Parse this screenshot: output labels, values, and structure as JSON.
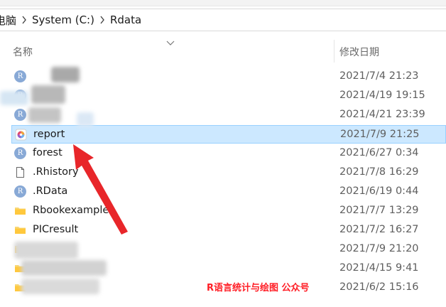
{
  "breadcrumb": {
    "items": [
      "电脑",
      "System (C:)",
      "Rdata"
    ]
  },
  "columns": {
    "name": "名称",
    "date": "修改日期"
  },
  "files": [
    {
      "name": "",
      "date": "2021/7/4 21:23",
      "icon": "r-file-icon"
    },
    {
      "name": "",
      "date": "2021/4/19 19:15",
      "icon": "r-file-icon"
    },
    {
      "name": "",
      "date": "2021/4/21 23:39",
      "icon": "r-file-icon"
    },
    {
      "name": "report",
      "date": "2021/7/9 21:25",
      "icon": "rstudio-file-icon",
      "selected": true
    },
    {
      "name": "forest",
      "date": "2021/6/27 0:34",
      "icon": "r-file-icon"
    },
    {
      "name": ".Rhistory",
      "date": "2021/7/8 16:29",
      "icon": "blank-file-icon"
    },
    {
      "name": ".RData",
      "date": "2021/6/19 0:44",
      "icon": "r-file-icon"
    },
    {
      "name": "Rbookexample",
      "date": "2021/7/7 13:29",
      "icon": "folder-icon"
    },
    {
      "name": "PICresult",
      "date": "2021/7/2 16:27",
      "icon": "folder-icon"
    },
    {
      "name": "",
      "date": "2021/7/9 21:20",
      "icon": "folder-icon"
    },
    {
      "name": "",
      "date": "2021/4/15 9:41",
      "icon": "folder-icon"
    },
    {
      "name": "",
      "date": "2021/6/2 15:16",
      "icon": "folder-icon"
    }
  ],
  "watermark": "R语言统计与绘图 公众号",
  "colors": {
    "selection": "#cce8ff",
    "arrow": "#e8262a",
    "watermark": "#ff1d25"
  }
}
